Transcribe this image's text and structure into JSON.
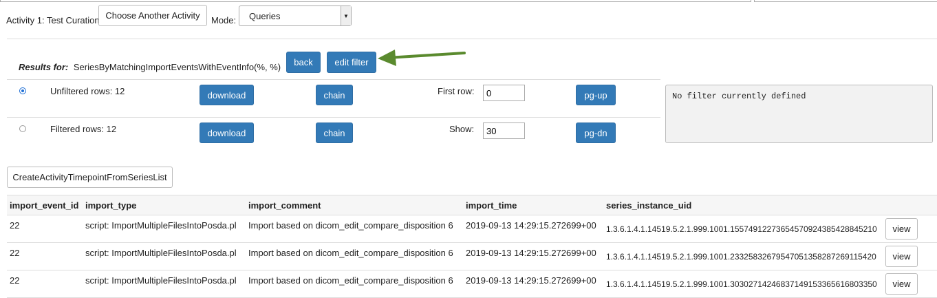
{
  "header": {
    "activity_label": "Activity 1: Test Curation",
    "choose_button": "Choose Another Activity",
    "mode_label": "Mode:",
    "mode_value": "Queries"
  },
  "results": {
    "prefix": "Results for:",
    "query": "SeriesByMatchingImportEventsWithEventInfo(%, %)",
    "back_label": "back",
    "edit_filter_label": "edit filter"
  },
  "controls": {
    "unfiltered_label": "Unfiltered rows: 12",
    "filtered_label": "Filtered rows: 12",
    "download_label": "download",
    "chain_label": "chain",
    "first_row_label": "First row:",
    "first_row_value": "0",
    "show_label": "Show:",
    "show_value": "30",
    "pg_up_label": "pg-up",
    "pg_dn_label": "pg-dn",
    "filter_text": "No filter currently defined"
  },
  "create_button": "CreateActivityTimepointFromSeriesList",
  "table": {
    "columns": [
      "import_event_id",
      "import_type",
      "import_comment",
      "import_time",
      "series_instance_uid"
    ],
    "view_label": "view",
    "rows": [
      [
        "22",
        "script: ImportMultipleFilesIntoPosda.pl",
        "Import based on dicom_edit_compare_disposition 6",
        "2019-09-13 14:29:15.272699+00",
        "1.3.6.1.4.1.14519.5.2.1.999.1001.15574912273654570924385428845210"
      ],
      [
        "22",
        "script: ImportMultipleFilesIntoPosda.pl",
        "Import based on dicom_edit_compare_disposition 6",
        "2019-09-13 14:29:15.272699+00",
        "1.3.6.1.4.1.14519.5.2.1.999.1001.23325832679547051358287269115420"
      ],
      [
        "22",
        "script: ImportMultipleFilesIntoPosda.pl",
        "Import based on dicom_edit_compare_disposition 6",
        "2019-09-13 14:29:15.272699+00",
        "1.3.6.1.4.1.14519.5.2.1.999.1001.30302714246837149153365616803350"
      ]
    ]
  },
  "colors": {
    "accent": "#337ab7",
    "arrow": "#5a8a2e"
  },
  "icons": {
    "annotation_arrow": "arrow-left-icon",
    "mode_dropdown": "chevron-down-icon"
  }
}
